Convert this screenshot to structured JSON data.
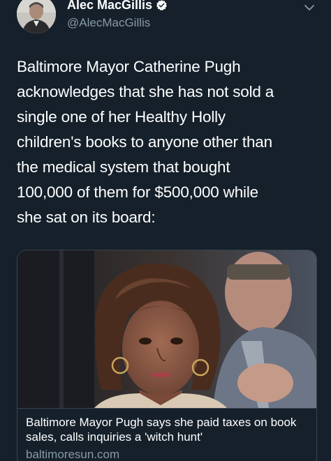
{
  "author": {
    "name": "Alec MacGillis",
    "handle": "@AlecMacGillis",
    "verified": true
  },
  "tweet": {
    "text": "Baltimore Mayor Catherine Pugh\nacknowledges that she has not sold a\nsingle one of her Healthy Holly\nchildren's books to anyone other than\nthe medical system that bought\n100,000 of them for $500,000 while\nshe sat on its board:"
  },
  "card": {
    "title": "Baltimore Mayor Pugh says she paid taxes on book sales, calls inquiries a 'witch hunt'",
    "domain": "baltimoresun.com"
  },
  "icons": {
    "verified": "verified-badge-icon",
    "menu": "chevron-down-icon"
  },
  "colors": {
    "background": "#15202b",
    "secondary_text": "#8899a6",
    "border": "#38444d",
    "text": "#ffffff"
  }
}
